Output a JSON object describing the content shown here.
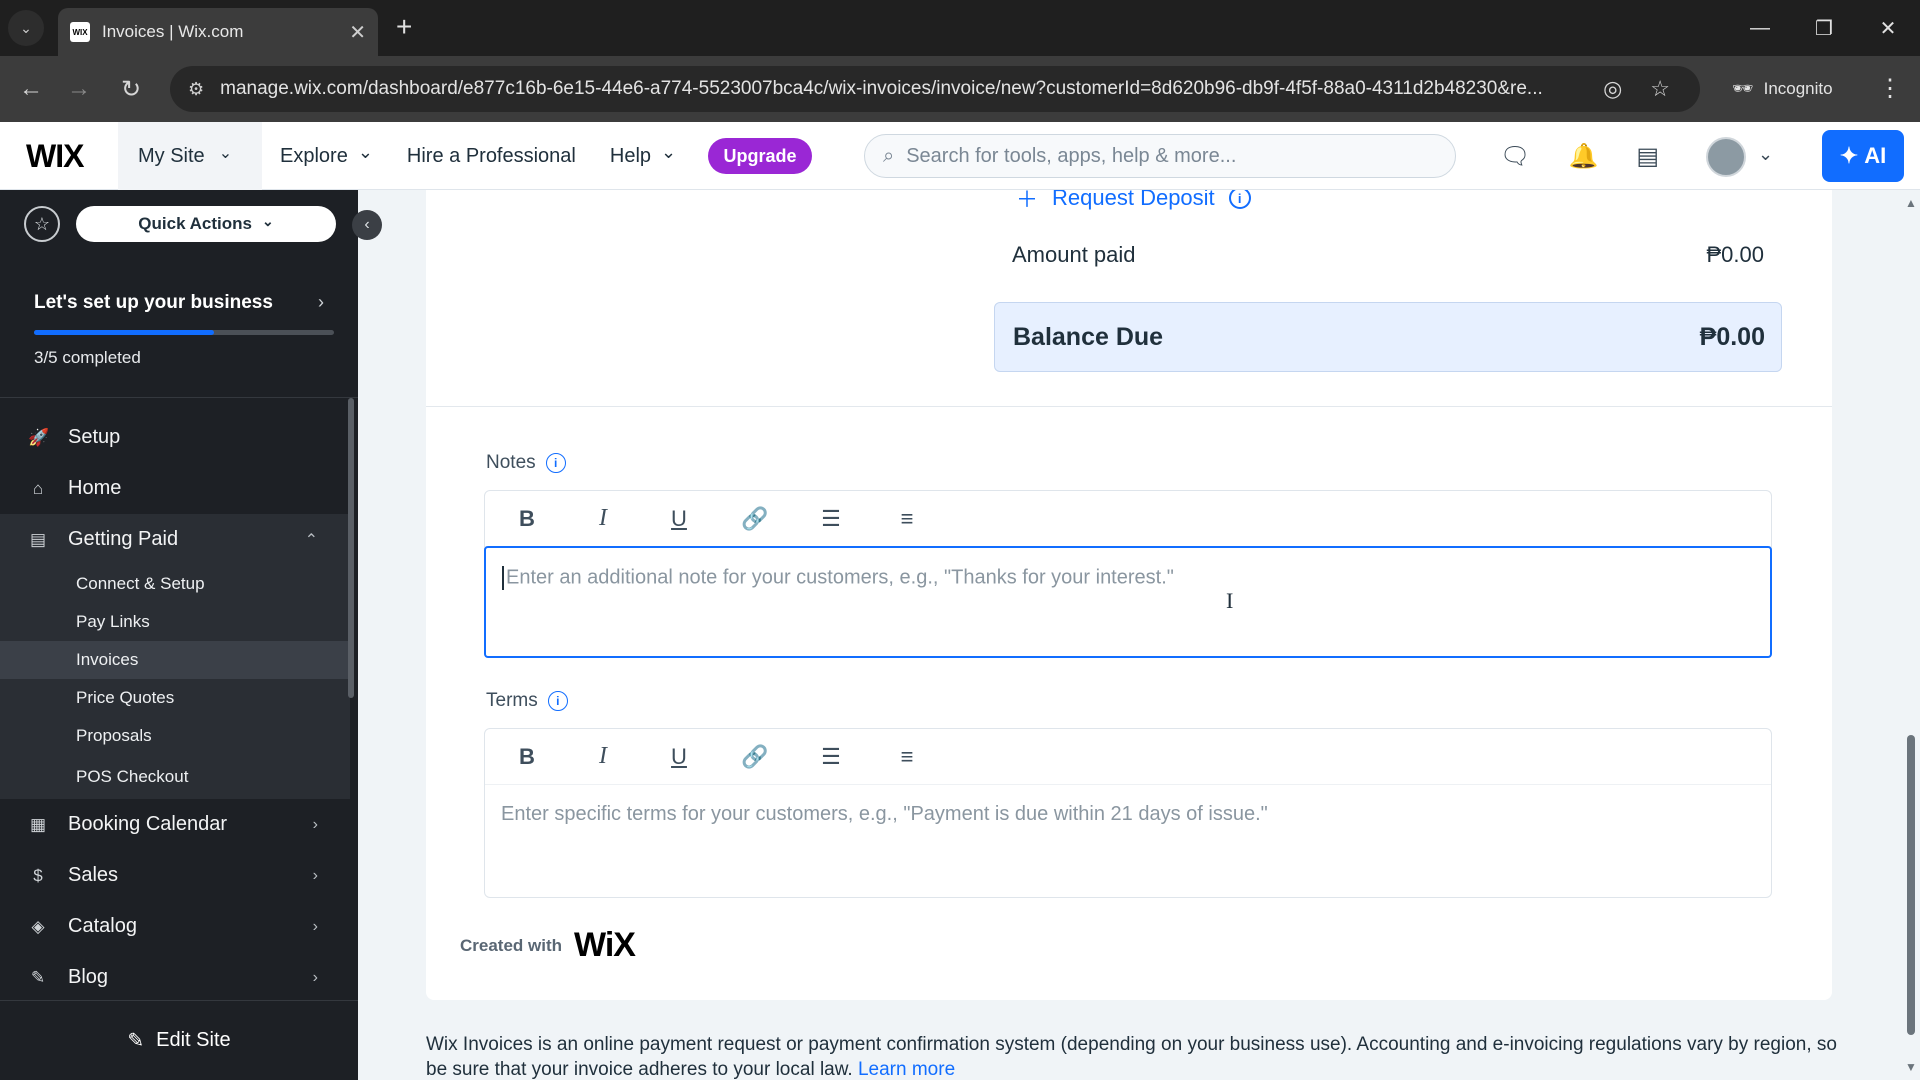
{
  "browser": {
    "tab_title": "Invoices | Wix.com",
    "url": "manage.wix.com/dashboard/e877c16b-6e15-44e6-a774-5523007bca4c/wix-invoices/invoice/new?customerId=8d620b96-db9f-4f5f-88a0-4311d2b48230&re...",
    "incognito_label": "Incognito"
  },
  "wix_bar": {
    "logo": "WIX",
    "my_site": "My Site",
    "menu": [
      "Explore",
      "Hire a Professional",
      "Help"
    ],
    "upgrade": "Upgrade",
    "search_placeholder": "Search for tools, apps, help & more...",
    "ai_label": "AI"
  },
  "sidebar": {
    "quick_actions": "Quick Actions",
    "setup_title": "Let's set up your business",
    "setup_progress": 0.6,
    "setup_count": "3/5 completed",
    "items": [
      {
        "label": "Setup",
        "icon": "rocket-icon"
      },
      {
        "label": "Home",
        "icon": "home-icon"
      },
      {
        "label": "Getting Paid",
        "icon": "payment-icon"
      }
    ],
    "sub_items": [
      "Connect & Setup",
      "Pay Links",
      "Invoices",
      "Price Quotes",
      "Proposals",
      "POS Checkout"
    ],
    "lower_items": [
      {
        "label": "Booking Calendar",
        "icon": "calendar-icon"
      },
      {
        "label": "Sales",
        "icon": "dollar-icon"
      },
      {
        "label": "Catalog",
        "icon": "catalog-icon"
      },
      {
        "label": "Blog",
        "icon": "blog-icon"
      }
    ],
    "edit_site": "Edit Site"
  },
  "invoice": {
    "request_deposit": "Request Deposit",
    "amount_paid_label": "Amount paid",
    "amount_paid_value": "₱0.00",
    "balance_due_label": "Balance Due",
    "balance_due_value": "₱0.00",
    "notes_label": "Notes",
    "notes_placeholder": "Enter an additional note for your customers, e.g., \"Thanks for your interest.\"",
    "terms_label": "Terms",
    "terms_placeholder": "Enter specific terms for your customers, e.g., \"Payment is due within 21 days of issue.\"",
    "created_with": "Created with",
    "created_logo": "WiX"
  },
  "footer": {
    "text": "Wix Invoices is an online payment request or payment confirmation system (depending on your business use). Accounting and e-invoicing regulations vary by region, so be sure that your invoice adheres to your local law.",
    "link": "Learn more"
  },
  "colors": {
    "accent": "#116dff",
    "upgrade": "#9a27d5",
    "sidebar_bg": "#1d2025"
  }
}
